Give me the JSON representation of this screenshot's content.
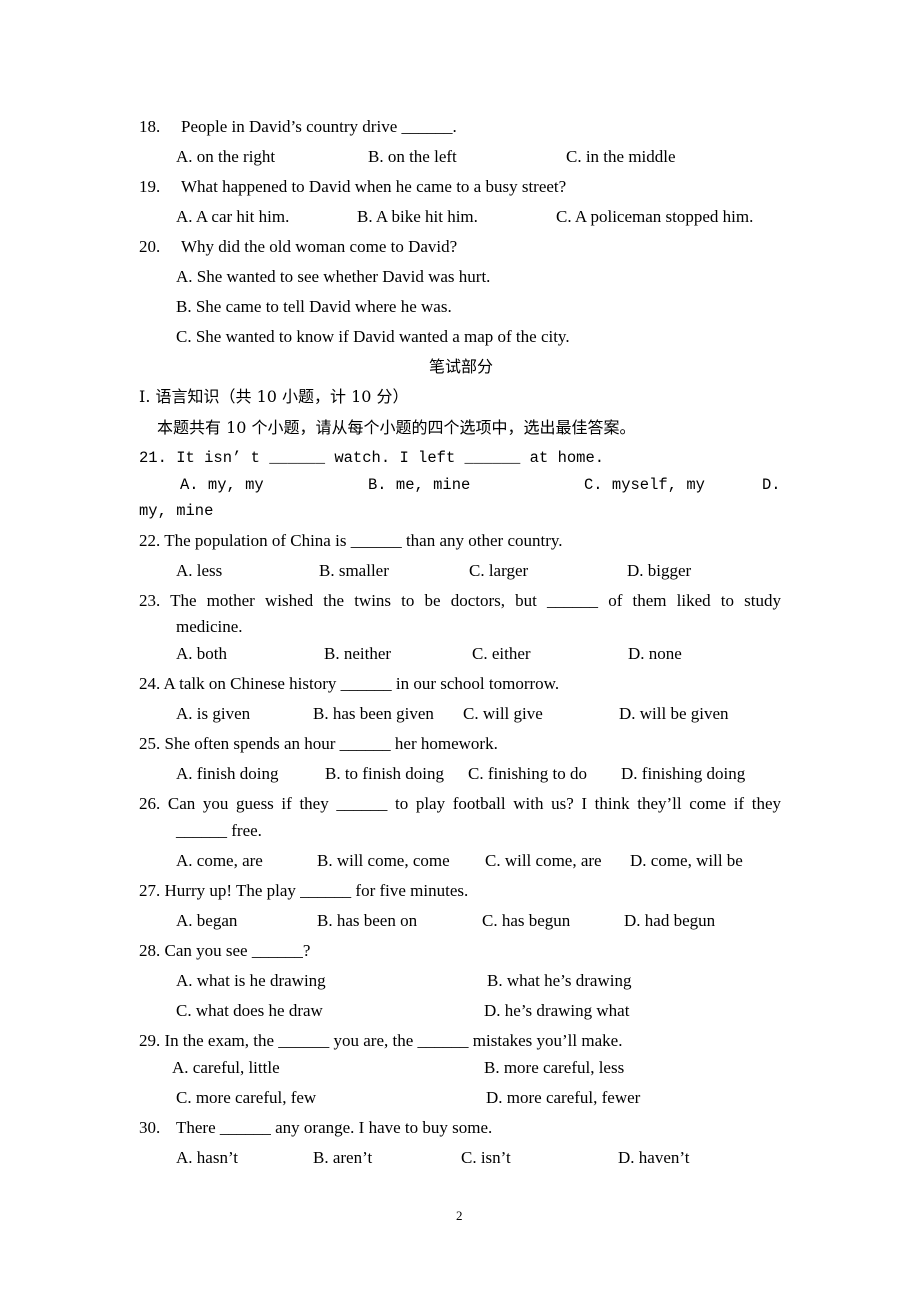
{
  "listening_questions": [
    {
      "number": "18.",
      "stem": "People in David’s country drive ______.",
      "options": [
        "A. on the right",
        "B. on the left",
        "C. in the middle"
      ]
    },
    {
      "number": "19.",
      "stem": "What happened to David when he came to a busy street?",
      "options": [
        "A. A car hit him.",
        "B. A bike hit him.",
        "C. A policeman stopped him."
      ]
    },
    {
      "number": "20.",
      "stem": "Why did the old woman come to David?",
      "options": [
        "A. She wanted to see whether David was hurt.",
        "B. She came to tell David where he was.",
        "C. She wanted to know if David wanted a map of the city."
      ]
    }
  ],
  "section_title": "笔试部分",
  "part_heading": "I. 语言知识（共 10 小题，计 10 分）",
  "part_instruction": "本题共有 10 个小题，请从每个小题的四个选项中，选出最佳答案。",
  "q21": {
    "stem": "21. It isn’ t ______ watch. I left ______ at home.",
    "options": [
      "A. my, my",
      "B. me, mine",
      "C. myself, my",
      "D."
    ],
    "wrap": "my, mine"
  },
  "q22": {
    "stem": "22. The population of China is ______ than any other country.",
    "options": [
      "A. less",
      "B. smaller",
      "C. larger",
      "D. bigger"
    ]
  },
  "q23": {
    "stem": "23. The mother wished the twins to be doctors, but ______ of them liked to study",
    "wrap": "medicine.",
    "options": [
      "A. both",
      "B. neither",
      "C. either",
      "D. none"
    ]
  },
  "q24": {
    "stem": "24. A talk on Chinese history ______ in our school tomorrow.",
    "options": [
      "A. is given",
      "B. has been given",
      "C. will give",
      "D. will be given"
    ]
  },
  "q25": {
    "stem": "25. She often spends an hour ______ her homework.",
    "options": [
      "A. finish doing",
      "B. to finish doing",
      "C. finishing to do",
      "D. finishing doing"
    ]
  },
  "q26": {
    "stem": "26. Can you guess if they ______ to play football with us? I think they’ll come if they",
    "wrap": "______ free.",
    "options": [
      "A. come, are",
      "B. will come, come",
      "C. will come, are",
      "D. come, will be"
    ]
  },
  "q27": {
    "stem": "27. Hurry up! The play ______ for five minutes.",
    "options": [
      "A. began",
      "B. has been on",
      "C. has begun",
      "D. had begun"
    ]
  },
  "q28": {
    "stem": "28. Can you see ______?",
    "options": [
      "A. what is he drawing",
      "B. what he’s drawing",
      "C. what does he draw",
      "D. he’s drawing what"
    ]
  },
  "q29": {
    "stem": "29. In the exam, the ______ you are, the ______ mistakes you’ll make.",
    "options": [
      "A. careful, little",
      "B. more careful, less",
      "C. more careful, few",
      "D. more careful, fewer"
    ]
  },
  "q30": {
    "number": "30.",
    "stem": "There ______ any orange. I have to buy some.",
    "options": [
      "A. hasn’t",
      "B. aren’t",
      "C. isn’t",
      "D. haven’t"
    ]
  },
  "page_number": "2"
}
